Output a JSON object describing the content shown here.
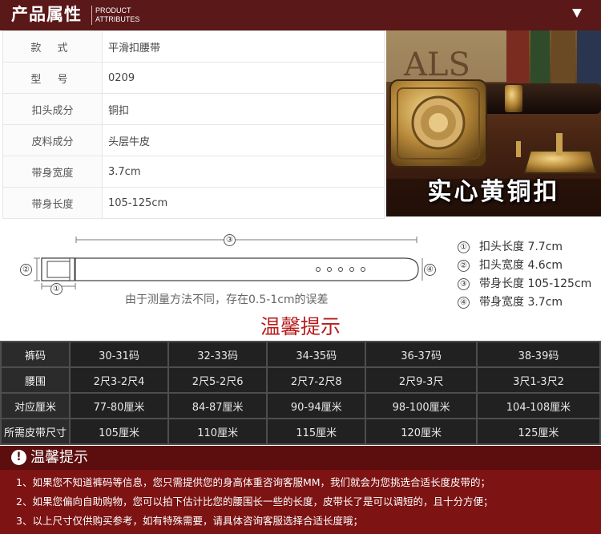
{
  "header": {
    "title": "产品属性",
    "subtitle_line1": "PRODUCT",
    "subtitle_line2": "ATTRIBUTES",
    "dropdown_icon": "triangle-down-icon"
  },
  "specs": [
    {
      "label": "款 式",
      "value": "平滑扣腰带"
    },
    {
      "label": "型 号",
      "value": "0209"
    },
    {
      "label": "扣头成分",
      "value": "铜扣"
    },
    {
      "label": "皮料成分",
      "value": "头层牛皮"
    },
    {
      "label": "带身宽度",
      "value": "3.7cm"
    },
    {
      "label": "带身长度",
      "value": "105-125cm"
    }
  ],
  "photo": {
    "background_text": "ALS",
    "caption": "实心黄铜扣"
  },
  "diagram": {
    "markers": [
      "①",
      "②",
      "③",
      "④"
    ],
    "note": "由于测量方法不同，存在0.5-1cm的误差",
    "legend": [
      {
        "num": "①",
        "text": "扣头长度 7.7cm"
      },
      {
        "num": "②",
        "text": "扣头宽度 4.6cm"
      },
      {
        "num": "③",
        "text": "带身长度 105-125cm"
      },
      {
        "num": "④",
        "text": "带身宽度 3.7cm"
      }
    ]
  },
  "tips_title": "温馨提示",
  "size_table": {
    "rows": [
      {
        "header": "裤码",
        "cells": [
          "30-31码",
          "32-33码",
          "34-35码",
          "36-37码",
          "38-39码"
        ]
      },
      {
        "header": "腰围",
        "cells": [
          "2尺3-2尺4",
          "2尺5-2尺6",
          "2尺7-2尺8",
          "2尺9-3尺",
          "3尺1-3尺2"
        ]
      },
      {
        "header": "对应厘米",
        "cells": [
          "77-80厘米",
          "84-87厘米",
          "90-94厘米",
          "98-100厘米",
          "104-108厘米"
        ]
      },
      {
        "header": "所需皮带尺寸",
        "cells": [
          "105厘米",
          "110厘米",
          "115厘米",
          "120厘米",
          "125厘米"
        ]
      }
    ]
  },
  "tips_box": {
    "icon": "exclamation-icon",
    "excl": "!",
    "title": "温馨提示",
    "lines": [
      "1、如果您不知道裤码等信息，您只需提供您的身高体重咨询客服MM，我们就会为您挑选合适长度皮带的；",
      "2、如果您偏向自助购物，您可以拍下估计比您的腰围长一些的长度，皮带长了是可以调短的，且十分方便；",
      "3、以上尺寸仅供购买参考，如有特殊需要，请具体咨询客服选择合适长度哦；"
    ]
  },
  "colors": {
    "header_bg": "#5a1818",
    "tips_red": "#b81c1c",
    "table_bg": "#212121",
    "tips_box_bg": "#7d1313"
  }
}
